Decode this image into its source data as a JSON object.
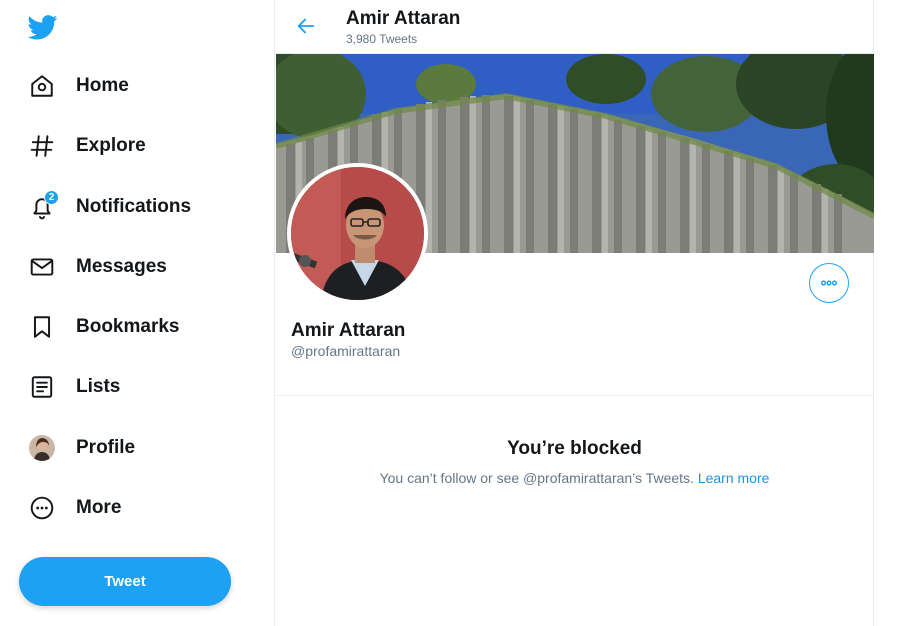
{
  "sidebar": {
    "logo_icon": "twitter-bird-icon",
    "items": [
      {
        "label": "Home",
        "icon": "home-icon"
      },
      {
        "label": "Explore",
        "icon": "hashtag-icon"
      },
      {
        "label": "Notifications",
        "icon": "bell-icon",
        "badge": "2"
      },
      {
        "label": "Messages",
        "icon": "envelope-icon"
      },
      {
        "label": "Bookmarks",
        "icon": "bookmark-icon"
      },
      {
        "label": "Lists",
        "icon": "list-icon"
      },
      {
        "label": "Profile",
        "icon": "avatar"
      },
      {
        "label": "More",
        "icon": "more-circle-icon"
      }
    ],
    "tweet_label": "Tweet"
  },
  "header": {
    "title": "Amir Attaran",
    "subtitle": "3,980 Tweets"
  },
  "profile": {
    "name": "Amir Attaran",
    "handle": "@profamirattaran"
  },
  "blocked": {
    "title": "You’re blocked",
    "message": "You can’t follow or see @profamirattaran’s Tweets.",
    "link": "Learn more"
  },
  "colors": {
    "accent": "#1da1f2",
    "text": "#14171a",
    "muted": "#657786",
    "border": "#e6ecf0"
  }
}
